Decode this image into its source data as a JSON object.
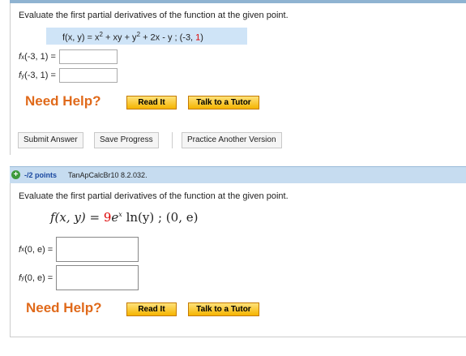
{
  "q1": {
    "question": "Evaluate the first partial derivatives of the function at the given point.",
    "function_text": "f(x, y) = x",
    "function_sup1": "2",
    "function_mid": " + xy + y",
    "function_sup2": "2",
    "function_tail": " + 2x - y ;  (-3, ",
    "point_y": "1",
    "point_close": ")",
    "fx_label": "f",
    "fx_sub": "x",
    "fx_point": "(-3, 1)  =",
    "fy_label": "f",
    "fy_sub": "y",
    "fy_point": "(-3, 1)  =",
    "fx_value": "",
    "fy_value": "",
    "need_help": "Need Help?",
    "read_it": "Read It",
    "talk_tutor": "Talk to a Tutor"
  },
  "actions": {
    "submit": "Submit Answer",
    "save": "Save Progress",
    "practice": "Practice Another Version"
  },
  "q2": {
    "plus_icon": "+",
    "points": "-/2 points",
    "code": "TanApCalcBr10 8.2.032.",
    "question": "Evaluate the first partial derivatives of the function at the given point.",
    "f_lhs": "f(x, y) = ",
    "f_nine": "9",
    "f_e": "e",
    "f_exp": "x",
    "f_ln": " ln(y)",
    "f_point": " ;   (0,  e)",
    "fx_label": "f",
    "fx_sub": "x",
    "fx_point": "(0, e)  =",
    "fy_label": "f",
    "fy_sub": "y",
    "fy_point": "(0, e)  =",
    "fx_value": "",
    "fy_value": "",
    "need_help": "Need Help?",
    "read_it": "Read It",
    "talk_tutor": "Talk to a Tutor"
  }
}
